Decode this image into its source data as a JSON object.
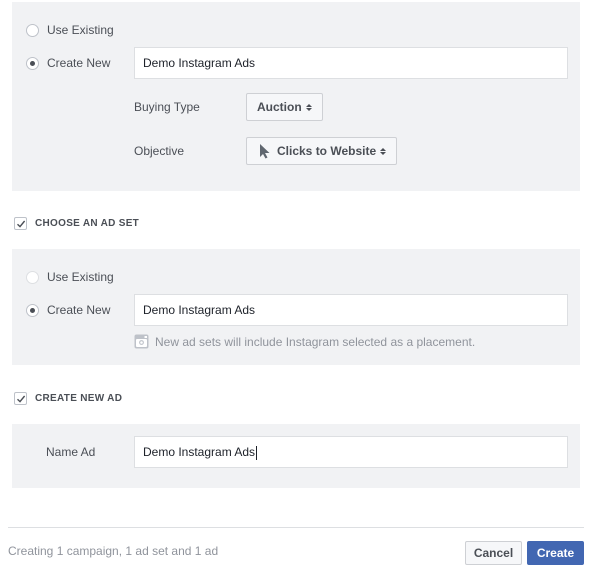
{
  "campaign": {
    "use_existing_label": "Use Existing",
    "create_new_label": "Create New",
    "name_value": "Demo Instagram Ads",
    "buying_type_label": "Buying Type",
    "buying_type_value": "Auction",
    "objective_label": "Objective",
    "objective_value": "Clicks to Website",
    "selected": "create_new"
  },
  "ad_set": {
    "section_label": "CHOOSE AN AD SET",
    "checked": true,
    "use_existing_label": "Use Existing",
    "create_new_label": "Create New",
    "name_value": "Demo Instagram Ads",
    "hint": "New ad sets will include Instagram selected as a placement.",
    "selected": "create_new"
  },
  "ad": {
    "section_label": "CREATE NEW AD",
    "checked": true,
    "name_label": "Name Ad",
    "name_value": "Demo Instagram Ads"
  },
  "footer": {
    "summary": "Creating 1 campaign, 1 ad set and 1 ad",
    "cancel_label": "Cancel",
    "create_label": "Create"
  },
  "icons": {
    "objective": "cursor-icon",
    "hint": "instagram-icon",
    "check": "checkmark-icon"
  },
  "colors": {
    "panel_bg": "#f1f2f4",
    "primary": "#4267b2",
    "text": "#4b4f56",
    "muted": "#90949c"
  }
}
